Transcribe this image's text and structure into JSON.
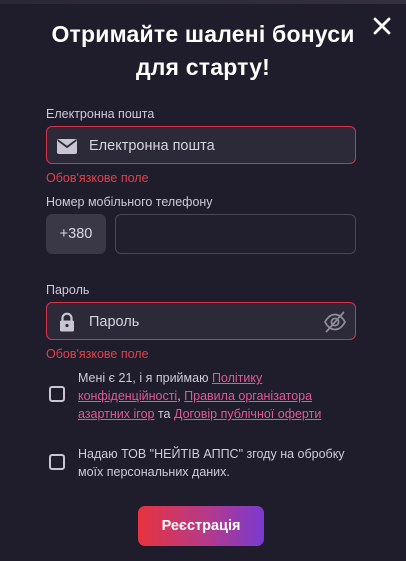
{
  "title": "Отримайте шалені бонуси для старту!",
  "email": {
    "label": "Електронна пошта",
    "placeholder": "Електронна пошта",
    "value": "",
    "error": "Обов'язкове поле",
    "icon": "envelope-icon"
  },
  "phone": {
    "label": "Номер мобільного телефону",
    "prefix": "+380",
    "value": ""
  },
  "password": {
    "label": "Пароль",
    "placeholder": "Пароль",
    "value": "",
    "error": "Обов'язкове поле",
    "icon": "lock-icon",
    "toggle_icon": "eye-off-icon"
  },
  "consent": {
    "checked": false,
    "text_1": "Мені є 21, і я приймаю ",
    "link_privacy": "Політику конфіденційності",
    "sep_1": ", ",
    "link_rules": "Правила організатора азартних ігор",
    "sep_2": " та ",
    "link_offer": "Договір публічної оферти"
  },
  "data_consent": {
    "checked": false,
    "text": "Надаю ТОВ \"НЕЙТІВ АППС\" згоду на обробку моїх персональних даних."
  },
  "register_button": "Реєстрація",
  "colors": {
    "background": "#1f1c2b",
    "error": "#e0424a",
    "link": "#e05a9a",
    "button_gradient_start": "#e8333e",
    "button_gradient_end": "#7a3ad0"
  }
}
